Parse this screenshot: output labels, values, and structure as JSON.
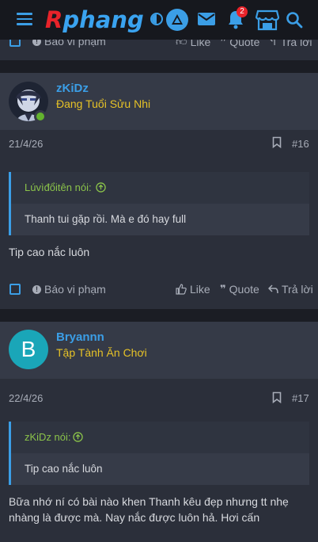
{
  "header": {
    "logo_first": "R",
    "logo_rest": "phang",
    "notification_count": "2",
    "icons": [
      "menu-icon",
      "theme-toggle-icon",
      "triangle-logo-icon",
      "mail-icon",
      "bell-icon",
      "store-icon",
      "search-icon"
    ]
  },
  "actions": {
    "report": "Báo vi phạm",
    "like": "Like",
    "quote": "Quote",
    "reply": "Trả lời"
  },
  "posts": [
    {
      "username": "zKiDz",
      "user_title": "Đang Tuổi Sửu Nhi",
      "date": "21/4/26",
      "number": "#16",
      "quote_author": "Lúvìđổitên nói:",
      "quote_text": "Thanh tui gặp rồi. Mà e đó hay full",
      "message": "Tip cao nắc luôn"
    },
    {
      "username": "Bryannn",
      "avatar_letter": "B",
      "user_title": "Tập Tành Ăn Chơi",
      "date": "22/4/26",
      "number": "#17",
      "quote_author": "zKiDz nói:",
      "quote_text": "Tip cao nắc luôn",
      "message": "Bữa nhớ ní có bài nào khen Thanh kêu đẹp nhưng tt nhẹ nhàng là được mà. Nay nắc được luôn hả. Hơi cấn"
    }
  ],
  "colors": {
    "accent": "#3b9ee6",
    "logo_red": "#e8232a",
    "username": "#3b9ee6",
    "user_title": "#e6c227",
    "quote_author": "#8bc34a",
    "avatar_b": "#1aa6b8"
  }
}
